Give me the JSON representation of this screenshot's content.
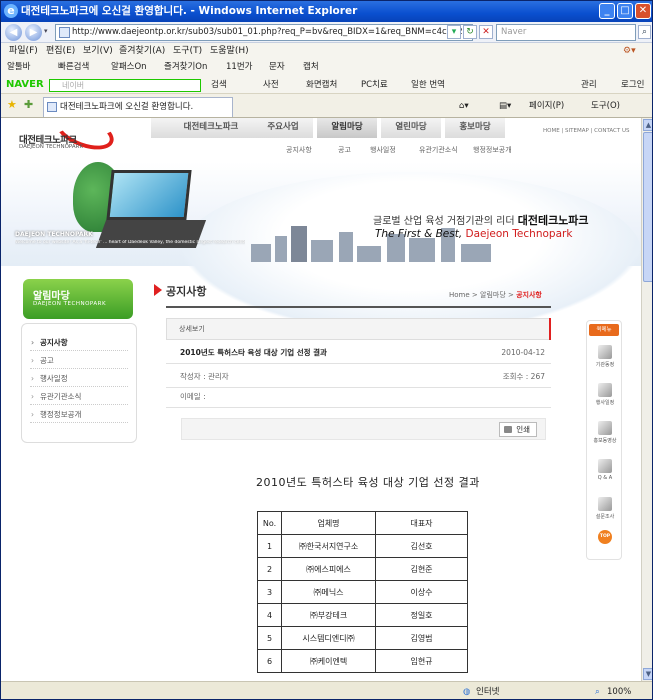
{
  "window": {
    "title": "대전테크노파크에 오신걸 환영합니다. - Windows Internet Explorer",
    "url": "http://www.daejeontp.or.kr/sub03/sub01_01.php?req_P=bv&req_BIDX=1&req_BNM=c4ca4238a0b923820c",
    "search_placeholder": "Naver"
  },
  "menu": [
    "파일(F)",
    "편집(E)",
    "보기(V)",
    "즐겨찾기(A)",
    "도구(T)",
    "도움말(H)"
  ],
  "links_bar": [
    "알툴바",
    "빠른검색",
    "알패스On",
    "즐겨찾기On",
    "11번가",
    "문자",
    "캡처"
  ],
  "naver_bar": {
    "logo": "NAVER",
    "placeholder": "네이버",
    "items": [
      "검색",
      "사전",
      "화면캡처",
      "PC치료",
      "일한 번역",
      "관리",
      "로그인"
    ]
  },
  "tab": {
    "title": "대전테크노파크에 오신걸 환영합니다."
  },
  "command_bar": {
    "page": "페이지(P)",
    "tools": "도구(O)"
  },
  "site": {
    "logo_ko": "대전테크노파크",
    "logo_en": "DAEJEON TECHNOPARK",
    "gnb": [
      "대전테크노파크",
      "주요사업",
      "알림마당",
      "열린마당",
      "홍보마당"
    ],
    "util_nav": "HOME  |  SITEMAP  |  CONTACT US",
    "sub_nav": [
      "공지사항",
      "공고",
      "행사일정",
      "유관기관소식",
      "행정정보공개"
    ],
    "slogan_pre": "글로벌 산업 육성 거점기관의 리더",
    "slogan_bold": "대전테크노파크",
    "slogan_en_pre": "The First & Best,",
    "slogan_en_brand": "Daejeon Technopark",
    "visual_title": "DAEJEON TECHNOPARK",
    "visual_desc": "Welcome to our website! As a 'hi-tech' ... heart of Daedeok Valley, the domestic largest research center ... recognized by Daejeon T..."
  },
  "lnb": {
    "title": "알림마당",
    "subtitle": "DAEJEON TECHNOPARK",
    "items": [
      "공지사항",
      "공고",
      "행사일정",
      "유관기관소식",
      "행정정보공개"
    ]
  },
  "page": {
    "title": "공지사항",
    "breadcrumb_home": "Home",
    "breadcrumb_mid": "알림마당",
    "breadcrumb_cur": "공지사항",
    "detail_label": "상세보기",
    "post_title": "2010년도 특허스타 육성 대상 기업 선정 결과",
    "post_date": "2010-04-12",
    "author": "작성자 : 관리자",
    "views": "조회수 : 267",
    "email": "이메일 :",
    "print": "인쇄",
    "doc_title": "2010년도 특허스타 육성 대상 기업 선정 결과"
  },
  "table": {
    "headers": [
      "No.",
      "업체명",
      "대표자"
    ],
    "rows": [
      [
        "1",
        "㈜한국서지연구소",
        "김선호"
      ],
      [
        "2",
        "㈜에스피에스",
        "김현준"
      ],
      [
        "3",
        "㈜메닉스",
        "이상수"
      ],
      [
        "4",
        "㈜부강테크",
        "정일호"
      ],
      [
        "5",
        "시스템디엔디㈜",
        "김영범"
      ],
      [
        "6",
        "㈜케이엔텍",
        "임현규"
      ]
    ]
  },
  "quick_menu": {
    "header": "퀵메뉴",
    "items": [
      "기관동정",
      "행사일정",
      "홍보동영상",
      "Q & A",
      "설문조사"
    ],
    "top": "TOP"
  },
  "status": {
    "zone": "인터넷",
    "zoom": "100%"
  }
}
